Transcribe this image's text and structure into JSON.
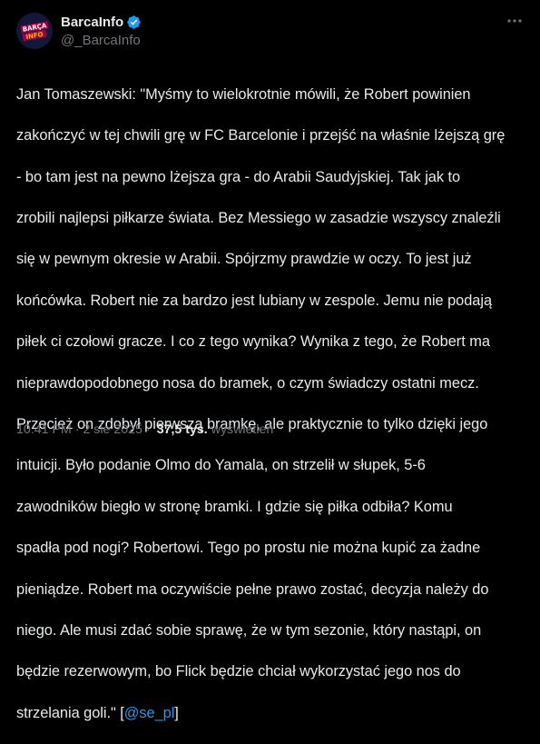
{
  "author": {
    "display_name": "BarcaInfo",
    "handle": "@_BarcaInfo",
    "avatar_label": "BARÇA INFO"
  },
  "tweet": {
    "text_lines": [
      "Jan Tomaszewski: \"Myśmy to wielokrotnie mówili, że Robert powinien",
      "zakończyć w tej chwili grę w FC Barcelonie i przejść na właśnie lżejszą grę",
      "- bo tam jest na pewno lżejsza gra - do Arabii Saudyjskiej. Tak jak to",
      "zrobili najlepsi piłkarze świata. Bez Messiego w zasadzie wszyscy znaleźli",
      "się w pewnym okresie w Arabii. Spójrzmy prawdzie w oczy. To jest już",
      "końcówka. Robert nie za bardzo jest lubiany w zespole. Jemu nie podają",
      "piłek ci czołowi gracze. I co z tego wynika? Wynika z tego, że Robert ma",
      "nieprawdopodobnego nosa do bramek, o czym świadczy ostatni mecz.",
      "Przecież on zdobył pierwszą bramkę, ale praktycznie to tylko dzięki jego",
      "intuicji. Było podanie Olmo do Yamala, on strzelił w słupek, 5-6",
      "zawodników biegło w stronę bramki. I gdzie się piłka odbiła? Komu",
      "spadła pod nogi? Robertowi. Tego po prostu nie można kupić za żadne",
      "pieniądze. Robert ma oczywiście pełne prawo zostać, decyzja należy do",
      "niego. Ale musi zdać sobie sprawę, że w tym sezonie, który nastąpi, on",
      "będzie rezerwowym, bo Flick będzie chciał wykorzystać jego nos do"
    ],
    "last_line_prefix": "strzelania goli.\" ",
    "bracket_open": "[",
    "mention": "@se_pl",
    "bracket_close": "]"
  },
  "meta": {
    "time": "10:41 PM",
    "separator": "·",
    "date": "2 sie 2025",
    "views_count": "37,5 tys.",
    "views_label": "wyświetleń"
  },
  "colors": {
    "background": "#000000",
    "text": "#e7e9ea",
    "secondary": "#71767b",
    "accent": "#1d9bf0"
  },
  "icons": {
    "verified": "verified-badge-icon",
    "more": "more-horizontal-icon"
  }
}
